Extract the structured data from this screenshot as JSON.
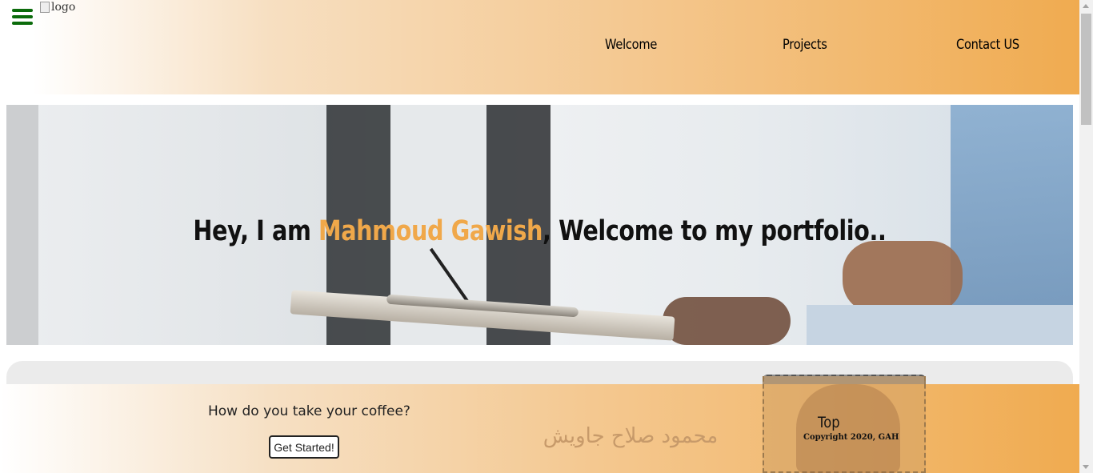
{
  "header": {
    "logo_alt": "logo",
    "nav": [
      {
        "label": "Welcome"
      },
      {
        "label": "Projects"
      },
      {
        "label": "Contact US"
      }
    ]
  },
  "hero": {
    "prefix": "Hey, I am ",
    "name": "Mahmoud Gawish",
    "suffix": ", Welcome to my portfolio.."
  },
  "footer": {
    "question": "How do you take your coffee?",
    "cta_label": "Get Started!",
    "arabic_name": "محمود صلاح جاويش",
    "top_label": "Top",
    "copyright": "Copyright 2020, GAH"
  },
  "colors": {
    "accent": "#f0a84a",
    "menu_icon": "#0b6b0b"
  }
}
